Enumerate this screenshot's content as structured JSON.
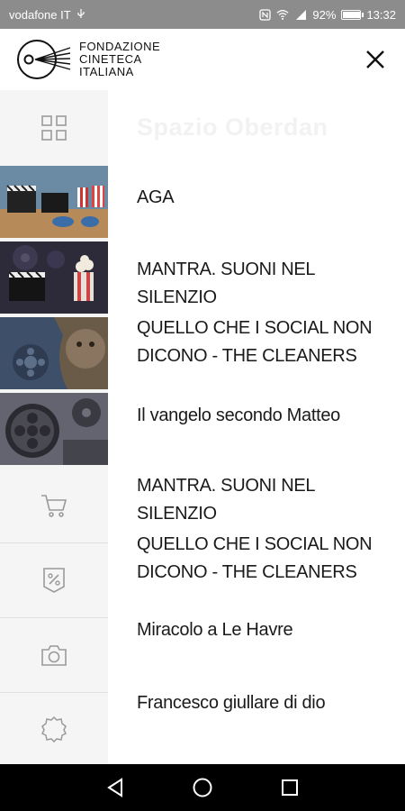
{
  "status_bar": {
    "carrier": "vodafone IT",
    "battery": "92%",
    "battery_level": 0.92,
    "time": "13:32"
  },
  "header": {
    "logo_line1": "FONDAZIONE",
    "logo_line2": "CINETECA",
    "logo_line3": "ITALIANA"
  },
  "panel": {
    "section_title": "Spazio Oberdan",
    "items": [
      "AGA",
      "MANTRA. SUONI NEL SILENZIO",
      "QUELLO CHE I SOCIAL NON DICONO - THE CLEANERS",
      "Il vangelo secondo Matteo",
      "MANTRA. SUONI NEL SILENZIO",
      "QUELLO CHE I SOCIAL NON DICONO - THE CLEANERS",
      "Miracolo a Le Havre",
      "Francesco giullare di dio"
    ]
  },
  "icons": {
    "grid": "grid-icon",
    "cart": "cart-icon",
    "discount": "discount-icon",
    "camera": "camera-icon",
    "settings": "settings-icon",
    "close": "close-icon"
  },
  "colors": {
    "status_bar": "#8c8c8c",
    "rail_bg": "#f5f5f5",
    "text": "#1a1a1a",
    "icon": "#9a9a9a"
  }
}
